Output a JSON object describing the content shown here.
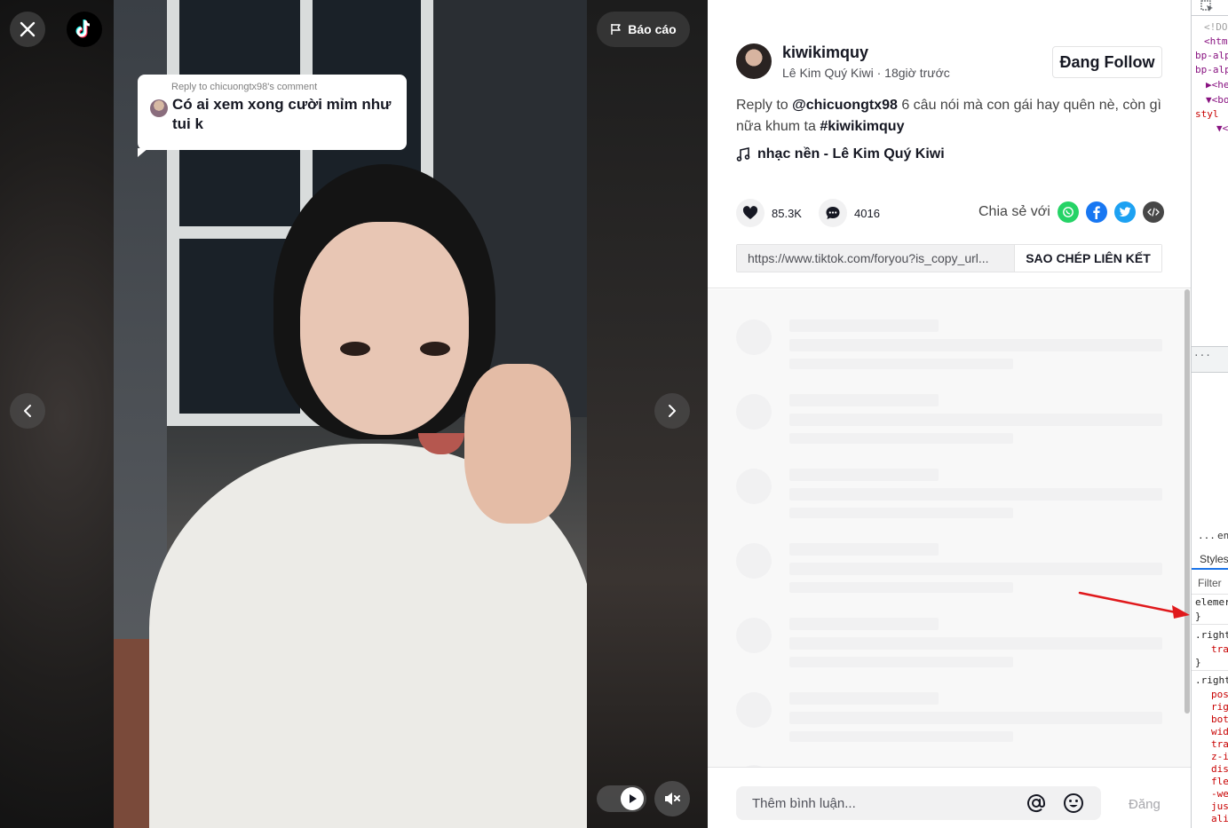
{
  "video": {
    "report_label": "Báo cáo",
    "reply_card": {
      "meta": "Reply to chicuongtx98's comment",
      "text": "Có ai xem xong cười mỉm như tui k"
    }
  },
  "post": {
    "username": "kiwikimquy",
    "display_name": "Lê Kim Quý Kiwi",
    "time": "18giờ trước",
    "follow_label": "Đang Follow",
    "desc_prefix": "Reply to ",
    "desc_mention": "@chicuongtx98",
    "desc_body": " 6 câu nói mà con gái hay quên nè, còn gì nữa khum ta ",
    "desc_hashtag": "#kiwikimquy",
    "music": "nhạc nền - Lê Kim Quý Kiwi",
    "likes": "85.3K",
    "comments": "4016",
    "share_label": "Chia sẻ với",
    "share_icons": [
      "whatsapp-icon",
      "facebook-icon",
      "twitter-icon",
      "embed-icon"
    ],
    "link_url": "https://www.tiktok.com/foryou?is_copy_url...",
    "copy_label": "SAO CHÉP LIÊN KẾT"
  },
  "comment_bar": {
    "placeholder": "Thêm bình luận...",
    "post_label": "Đăng"
  },
  "devtools": {
    "lines": [
      "<!DO",
      "<htm",
      "bp-alp",
      "bp-alp",
      "▶<he",
      "▼<bo",
      "styl",
      "▼<"
    ],
    "more": "...",
    "more2": "...",
    "partial": "en",
    "styles_tab": "Styles",
    "filter": "Filter",
    "css": [
      "elemer",
      "}",
      ".right",
      "tra",
      "}",
      ".right",
      "pos",
      "rig",
      "bot",
      "wid",
      "tra",
      "z-i",
      "dis",
      "fle",
      "-we",
      "jus",
      "ali"
    ]
  },
  "colors": {
    "primary": "#161823",
    "muted": "#4e4f55",
    "skeleton": "#f1f1f2",
    "whatsapp": "#25d366",
    "facebook": "#1877f2",
    "twitter": "#1da1f2",
    "embed": "#474747",
    "annotation_arrow": "#e0191c"
  }
}
